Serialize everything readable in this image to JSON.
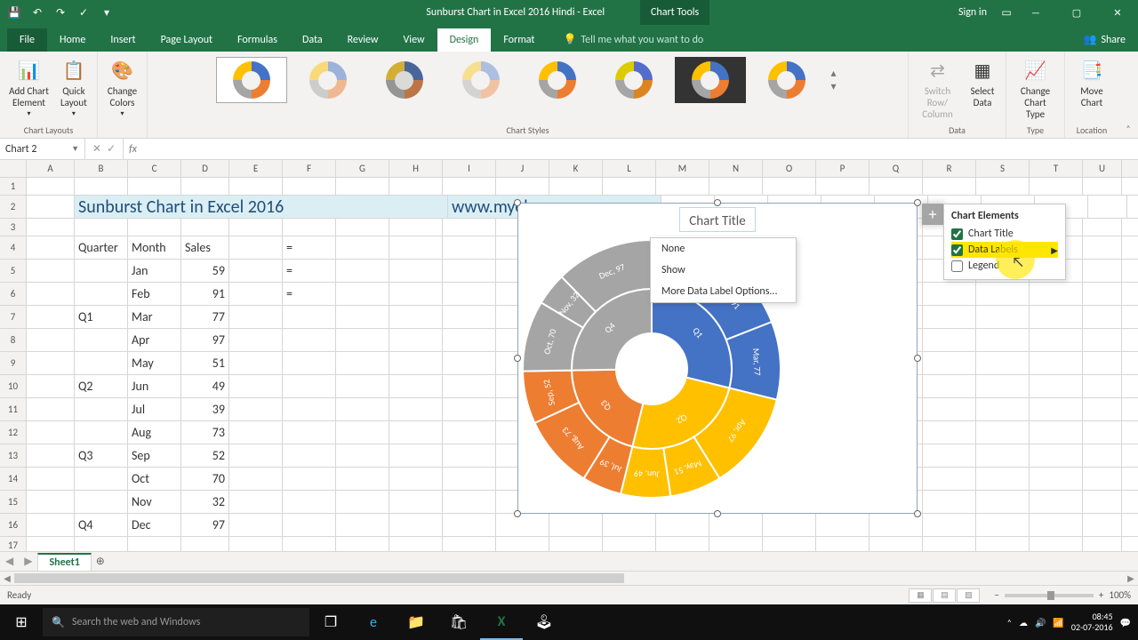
{
  "app": {
    "doc_title": "Sunburst Chart in Excel 2016 Hindi - Excel",
    "tools_tab": "Chart Tools",
    "sign_in": "Sign in"
  },
  "ribbon": {
    "tabs": [
      "File",
      "Home",
      "Insert",
      "Page Layout",
      "Formulas",
      "Data",
      "Review",
      "View",
      "Design",
      "Format"
    ],
    "active": "Design",
    "tellme": "Tell me what you want to do",
    "share": "Share",
    "groups": {
      "layouts": {
        "name": "Chart Layouts",
        "add_element": "Add Chart\nElement",
        "quick_layout": "Quick\nLayout"
      },
      "colors": {
        "change_colors": "Change\nColors"
      },
      "styles": {
        "name": "Chart Styles"
      },
      "data": {
        "name": "Data",
        "switch": "Switch Row/\nColumn",
        "select": "Select\nData"
      },
      "type": {
        "name": "Type",
        "change_type": "Change\nChart Type"
      },
      "location": {
        "name": "Location",
        "move": "Move\nChart"
      }
    }
  },
  "namebox": "Chart 2",
  "sheet": {
    "title": "Sunburst Chart in Excel 2016",
    "url": "www.myelesson.org",
    "headers": [
      "Quarter",
      "Month",
      "Sales"
    ],
    "formula_marker": "=",
    "rows": [
      {
        "q": "",
        "m": "Jan",
        "s": 59
      },
      {
        "q": "",
        "m": "Feb",
        "s": 91
      },
      {
        "q": "Q1",
        "m": "Mar",
        "s": 77
      },
      {
        "q": "",
        "m": "Apr",
        "s": 97
      },
      {
        "q": "",
        "m": "May",
        "s": 51
      },
      {
        "q": "Q2",
        "m": "Jun",
        "s": 49
      },
      {
        "q": "",
        "m": "Jul",
        "s": 39
      },
      {
        "q": "",
        "m": "Aug",
        "s": 73
      },
      {
        "q": "Q3",
        "m": "Sep",
        "s": 52
      },
      {
        "q": "",
        "m": "Oct",
        "s": 70
      },
      {
        "q": "",
        "m": "Nov",
        "s": 32
      },
      {
        "q": "Q4",
        "m": "Dec",
        "s": 97
      }
    ],
    "name": "Sheet1"
  },
  "chart_data": {
    "type": "sunburst",
    "title": "Chart Title",
    "inner": [
      {
        "name": "Q1",
        "color": "#4472c4",
        "children": [
          "Jan",
          "Feb",
          "Mar"
        ]
      },
      {
        "name": "Q2",
        "color": "#ffc000",
        "children": [
          "Apr",
          "May",
          "Jun"
        ]
      },
      {
        "name": "Q3",
        "color": "#ed7d31",
        "children": [
          "Jul",
          "Aug",
          "Sep"
        ]
      },
      {
        "name": "Q4",
        "color": "#a5a5a5",
        "children": [
          "Oct",
          "Nov",
          "Dec"
        ]
      }
    ],
    "values": {
      "Jan": 59,
      "Feb": 91,
      "Mar": 77,
      "Apr": 97,
      "May": 51,
      "Jun": 49,
      "Jul": 39,
      "Aug": 73,
      "Sep": 52,
      "Oct": 70,
      "Nov": 32,
      "Dec": 97
    }
  },
  "chart_elements": {
    "title": "Chart Elements",
    "items": [
      {
        "label": "Chart Title",
        "checked": true
      },
      {
        "label": "Data Labels",
        "checked": true,
        "sub": true
      },
      {
        "label": "Legend",
        "checked": false
      }
    ],
    "sub": [
      "None",
      "Show",
      "More Data Label Options..."
    ]
  },
  "status": {
    "ready": "Ready",
    "zoom": "100%"
  },
  "taskbar": {
    "search_placeholder": "Search the web and Windows",
    "time": "08:45",
    "date": "02-07-2016"
  }
}
